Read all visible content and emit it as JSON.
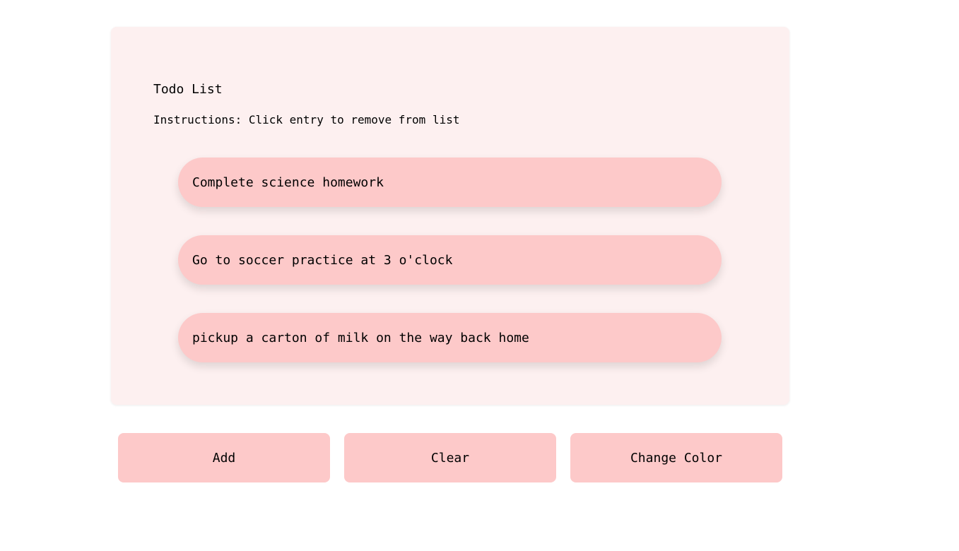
{
  "panel": {
    "title": "Todo List",
    "instructions": "Instructions: Click entry to remove from list",
    "items": [
      {
        "label": "Complete science homework"
      },
      {
        "label": "Go to soccer practice at 3 o'clock"
      },
      {
        "label": "pickup a carton of milk on the way back home"
      }
    ]
  },
  "buttons": {
    "add": "Add",
    "clear": "Clear",
    "change_color": "Change Color"
  },
  "colors": {
    "panel_bg": "#fdf0f0",
    "accent": "#fdc9c9"
  }
}
